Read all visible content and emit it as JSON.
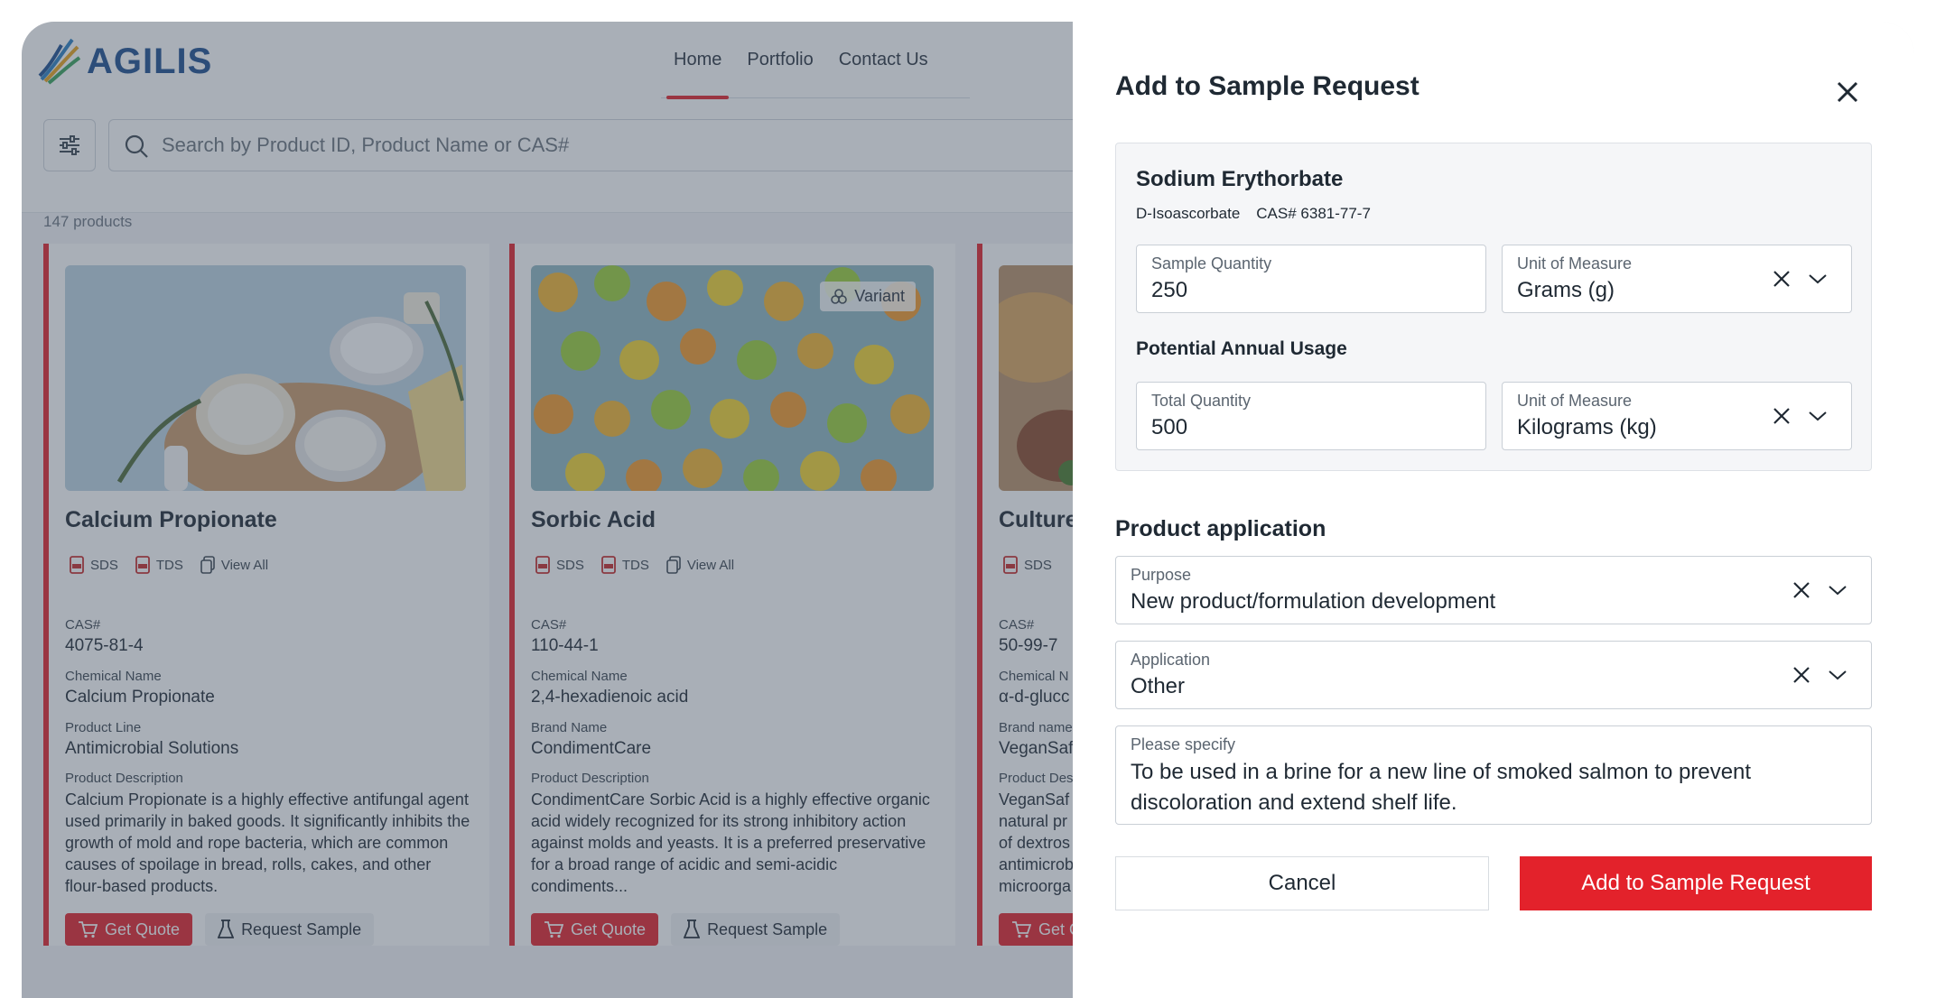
{
  "brand": {
    "name": "AGILIS",
    "color": "#1d4e8f",
    "accent": "#e3222b"
  },
  "nav": {
    "items": [
      "Home",
      "Portfolio",
      "Contact Us"
    ],
    "active": "Home"
  },
  "search": {
    "placeholder": "Search by Product ID, Product Name or CAS#"
  },
  "product_count": "147 products",
  "cards": [
    {
      "title": "Calcium Propionate",
      "docs": [
        "SDS",
        "TDS",
        "View All"
      ],
      "fields": [
        {
          "label": "CAS#",
          "value": "4075-81-4"
        },
        {
          "label": "Chemical Name",
          "value": "Calcium Propionate"
        },
        {
          "label": "Product Line",
          "value": "Antimicrobial Solutions"
        }
      ],
      "desc_label": "Product Description",
      "description": "Calcium Propionate is a highly effective antifungal agent used primarily in baked goods. It significantly inhibits the growth of mold and rope bacteria, which are common causes of spoilage in bread, rolls, cakes, and other flour-based products.",
      "quote": "Get Quote",
      "sample": "Request Sample"
    },
    {
      "title": "Sorbic Acid",
      "variant": "Variant",
      "docs": [
        "SDS",
        "TDS",
        "View All"
      ],
      "fields": [
        {
          "label": "CAS#",
          "value": "110-44-1"
        },
        {
          "label": "Chemical Name",
          "value": "2,4-hexadienoic acid"
        },
        {
          "label": "Brand Name",
          "value": "CondimentCare"
        }
      ],
      "desc_label": "Product Description",
      "description": "CondimentCare Sorbic Acid is a highly effective organic acid widely recognized for its strong inhibitory action against molds and yeasts. It is a preferred preservative for a broad range of acidic and semi-acidic condiments...",
      "quote": "Get Quote",
      "sample": "Request Sample"
    },
    {
      "title": "Cultured",
      "docs": [
        "SDS"
      ],
      "fields": [
        {
          "label": "CAS#",
          "value": "50-99-7"
        },
        {
          "label": "Chemical N",
          "value": "α-d-glucc"
        },
        {
          "label": "Brand name",
          "value": "VeganSaf"
        }
      ],
      "desc_label": "Product Desc",
      "description": "VeganSaf natural pr of dextros antimicrob microorga",
      "quote": "Get Q",
      "sample": ""
    }
  ],
  "modal": {
    "title": "Add to Sample Request",
    "product": {
      "name": "Sodium Erythorbate",
      "alt_name": "D-Isoascorbate",
      "cas": "CAS# 6381-77-7"
    },
    "sample_quantity": {
      "label": "Sample Quantity",
      "value": "250"
    },
    "sample_uom": {
      "label": "Unit of Measure",
      "value": "Grams (g)"
    },
    "annual_heading": "Potential Annual Usage",
    "total_quantity": {
      "label": "Total Quantity",
      "value": "500"
    },
    "annual_uom": {
      "label": "Unit of Measure",
      "value": "Kilograms (kg)"
    },
    "application_heading": "Product application",
    "purpose": {
      "label": "Purpose",
      "value": "New product/formulation development"
    },
    "application": {
      "label": "Application",
      "value": "Other"
    },
    "specify": {
      "label": "Please specify",
      "value": "To be used in a brine for a new line of smoked salmon to prevent discoloration and extend shelf life."
    },
    "cancel_label": "Cancel",
    "submit_label": "Add to Sample Request"
  }
}
